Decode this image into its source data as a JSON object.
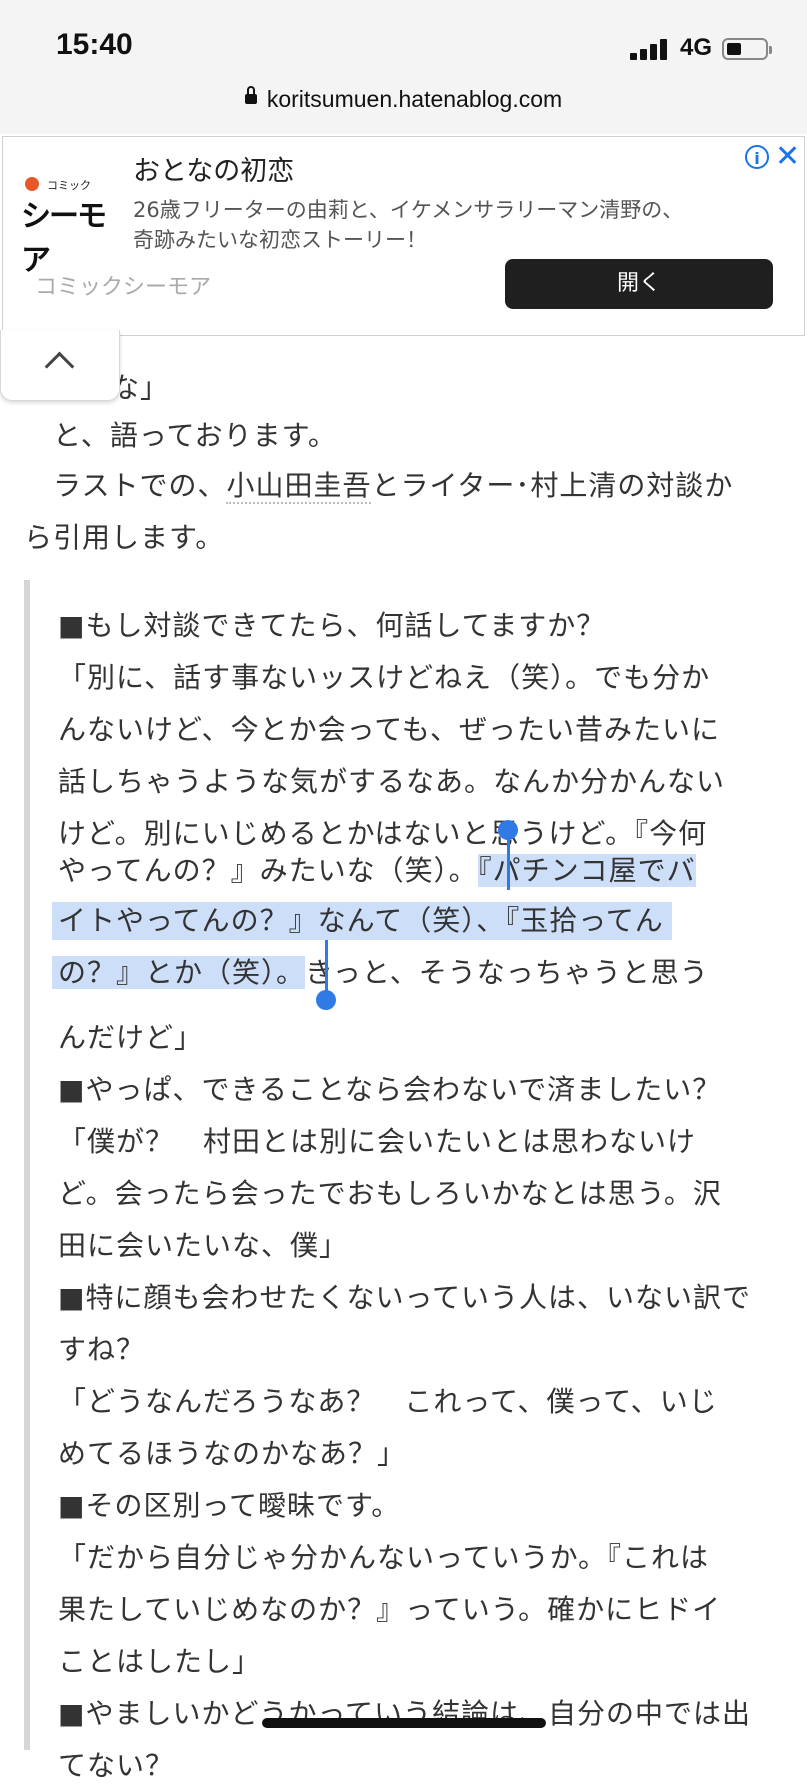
{
  "status": {
    "time": "15:40",
    "network": "4G"
  },
  "browser": {
    "url": "koritsumuen.hatenablog.com"
  },
  "ad": {
    "logo_top": "コミック",
    "logo_main": "シーモア",
    "title": "おとなの初恋",
    "desc_line1": "26歳フリーターの由莉と、イケメンサラリーマン清野の、",
    "desc_line2": "奇跡みたいな初恋ストーリー！",
    "brand": "コミックシーモア",
    "open_label": "開く",
    "info": "i",
    "close": "✕"
  },
  "article": {
    "line0": "るな」",
    "line1": "　と、語っております。",
    "line2_pre": "　ラストでの、",
    "line2_link": "小山田圭吾",
    "line2_post": "とライター･村上清の対談か",
    "line3": "ら引用します。"
  },
  "quote": {
    "l1": "■もし対談できてたら、何話してますか？",
    "l2": "「別に、話す事ないッスけどねえ（笑）。でも分か",
    "l3": "んないけど、今とか会っても、ぜったい昔みたいに",
    "l4": "話しちゃうような気がするなあ。なんか分かんない",
    "l5": "けど。別にいじめるとかはないと思うけど。『今何",
    "l6_pre": "やってんの？』みたいな（笑）。",
    "l6_sel": "『パチンコ屋でバ",
    "l7_sel": "イトやってんの？』なんて（笑）、『玉拾ってん",
    "l8_sel": "の？』とか（笑）。",
    "l8_post": "きっと、そうなっちゃうと思う",
    "l9": "んだけど」",
    "l10": "■やっぱ、できることなら会わないで済ましたい？",
    "l11": "「僕が？　村田とは別に会いたいとは思わないけ",
    "l12": "ど。会ったら会ったでおもしろいかなとは思う。沢",
    "l13": "田に会いたいな、僕」",
    "l14": "■特に顔も会わせたくないっていう人は、いない訳で",
    "l15": "すね？",
    "l16": "「どうなんだろうなあ？　これって、僕って、いじ",
    "l17": "めてるほうなのかなあ？」",
    "l18": "■その区別って曖昧です。",
    "l19": "「だから自分じゃ分かんないっていうか。『これは",
    "l20": "果たしていじめなのか？』っていう。確かにヒドイ",
    "l21": "ことはしたし」",
    "l22": "■やましいかどうかっていう結論は、自分の中では出",
    "l23": "てない？"
  },
  "colors": {
    "selection": "#cddff8",
    "handle": "#2f7ae5",
    "accent_link": "#1a73e8"
  }
}
